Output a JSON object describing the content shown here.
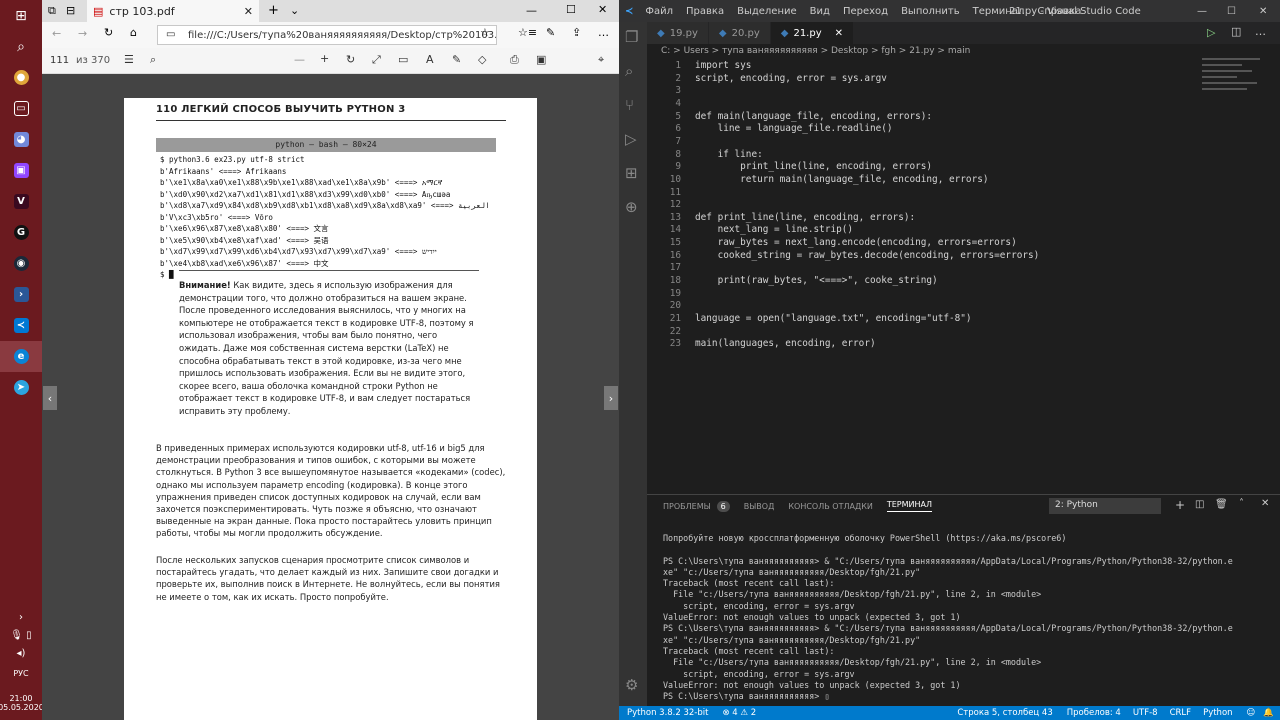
{
  "taskbar": {
    "items": [
      "windows-start",
      "search",
      "chrome",
      "taskview",
      "discord",
      "twitch",
      "vk",
      "game",
      "steam",
      "powershell",
      "vscode",
      "edge",
      "telegram"
    ],
    "tray": {
      "lang": "РУС",
      "time": "21:00",
      "date": "05.05.2020"
    }
  },
  "browser": {
    "tab_title": "стр 103.pdf",
    "url": "file:///C:/Users/тупа%20ваняяяяяяяяяя/Desktop/стр%20103.pdf",
    "page_current": "111",
    "page_total": "из 370",
    "pdf": {
      "header": "110   ЛЕГКИЙ СПОСОБ ВЫУЧИТЬ PYTHON 3",
      "terminal_title": "python — bash — 80×24",
      "terminal_lines": [
        "$ python3.6 ex23.py utf-8 strict",
        "b'Afrikaans' <===> Afrikaans",
        "b'\\xe1\\x8a\\xa0\\xe1\\x88\\x9b\\xe1\\x88\\xad\\xe1\\x8a\\x9b' <===> አማርኛ",
        "b'\\xd0\\x90\\xd2\\xa7\\xd1\\x81\\xd1\\x88\\xd3\\x99\\xd0\\xb0' <===> Аҧсшәа",
        "b'\\xd8\\xa7\\xd9\\x84\\xd8\\xb9\\xd8\\xb1\\xd8\\xa8\\xd9\\x8a\\xd8\\xa9' <===> العربية",
        "b'V\\xc3\\xb5ro' <===> Võro",
        "b'\\xe6\\x96\\x87\\xe8\\xa8\\x80' <===> 文言",
        "b'\\xe5\\x90\\xb4\\xe8\\xaf\\xad' <===> 吴语",
        "b'\\xd7\\x99\\xd7\\x99\\xd6\\xb4\\xd7\\x93\\xd7\\x99\\xd7\\xa9' <===> ייִדיש",
        "b'\\xe4\\xb8\\xad\\xe6\\x96\\x87' <===> 中文",
        "$ █"
      ],
      "note_bold": "Внимание!",
      "note_text": " Как видите, здесь я использую изображения для демонстрации того, что должно отобразиться на вашем экране. После проведенного исследования выяснилось, что у многих на компьютере не отображается текст в кодировке UTF-8, поэтому я использовал изображения, чтобы вам было понятно, чего ожидать. Даже моя собственная система верстки (LaTeX) не способна обрабатывать текст в этой кодировке, из-за чего мне пришлось использовать изображения. Если вы не видите этого, скорее всего, ваша оболочка командной строки Python не отображает текст в кодировке UTF-8, и вам следует постараться исправить эту проблему.",
      "para1": "В приведенных примерах используются кодировки utf-8, utf-16 и big5 для демонстрации преобразования и типов ошибок, с которыми вы можете столкнуться. В Python 3 все вышеупомянутое называется «кодеками» (codec), однако мы используем параметр encoding (кодировка). В конце этого упражнения приведен список доступных кодировок на случай, если вам захочется поэкспериментировать. Чуть позже я объясню, что означают выведенные на экран данные. Пока просто постарайтесь уловить принцип работы, чтобы мы могли продолжить обсуждение.",
      "para2": "После нескольких запусков сценария просмотрите список символов и постарайтесь угадать, что делает каждый из них. Запишите свои догадки и проверьте их, выполнив поиск в Интернете. Не волнуйтесь, если вы понятия не имеете о том, как их искать. Просто попробуйте."
    }
  },
  "vscode": {
    "menu": [
      "Файл",
      "Правка",
      "Выделение",
      "Вид",
      "Переход",
      "Выполнить",
      "Терминал",
      "Справка"
    ],
    "window_title": "21.py - Visual Studio Code",
    "tabs": [
      "19.py",
      "20.py",
      "21.py"
    ],
    "breadcrumb": "C: > Users > тупа ваняяяяяяяяяя > Desktop > fgh > 21.py > main",
    "code_lines": [
      {
        "n": "1",
        "t": "import sys"
      },
      {
        "n": "2",
        "t": "script, encoding, error = sys.argv"
      },
      {
        "n": "3",
        "t": ""
      },
      {
        "n": "4",
        "t": ""
      },
      {
        "n": "5",
        "t": "def main(language_file, encoding, errors):"
      },
      {
        "n": "6",
        "t": "    line = language_file.readline()"
      },
      {
        "n": "7",
        "t": ""
      },
      {
        "n": "8",
        "t": "    if line:"
      },
      {
        "n": "9",
        "t": "        print_line(line, encoding, errors)"
      },
      {
        "n": "10",
        "t": "        return main(language_file, encoding, errors)"
      },
      {
        "n": "11",
        "t": ""
      },
      {
        "n": "12",
        "t": ""
      },
      {
        "n": "13",
        "t": "def print_line(line, encoding, errors):"
      },
      {
        "n": "14",
        "t": "    next_lang = line.strip()"
      },
      {
        "n": "15",
        "t": "    raw_bytes = next_lang.encode(encoding, errors=errors)"
      },
      {
        "n": "16",
        "t": "    cooked_string = raw_bytes.decode(encoding, errors=errors)"
      },
      {
        "n": "17",
        "t": ""
      },
      {
        "n": "18",
        "t": "    print(raw_bytes, \"<===>\", cooke_string)"
      },
      {
        "n": "19",
        "t": ""
      },
      {
        "n": "20",
        "t": ""
      },
      {
        "n": "21",
        "t": "language = open(\"language.txt\", encoding=\"utf-8\")"
      },
      {
        "n": "22",
        "t": ""
      },
      {
        "n": "23",
        "t": "main(languages, encoding, error)"
      }
    ],
    "panel_tabs": [
      "ПРОБЛЕМЫ",
      "6",
      "ВЫВОД",
      "КОНСОЛЬ ОТЛАДКИ",
      "ТЕРМИНАЛ"
    ],
    "terminal_select": "2: Python",
    "terminal_text": "Попробуйте новую кроссплатформенную оболочку PowerShell (https://aka.ms/pscore6)\n\nPS C:\\Users\\тупа ваняяяяяяяяяя> & \"C:/Users/тупа ваняяяяяяяяяя/AppData/Local/Programs/Python/Python38-32/python.e\nxe\" \"c:/Users/тупа ваняяяяяяяяяя/Desktop/fgh/21.py\"\nTraceback (most recent call last):\n  File \"c:/Users/тупа ваняяяяяяяяяя/Desktop/fgh/21.py\", line 2, in <module>\n    script, encoding, error = sys.argv\nValueError: not enough values to unpack (expected 3, got 1)\nPS C:\\Users\\тупа ваняяяяяяяяяя> & \"C:/Users/тупа ваняяяяяяяяяя/AppData/Local/Programs/Python/Python38-32/python.e\nxe\" \"c:/Users/тупа ваняяяяяяяяяя/Desktop/fgh/21.py\"\nTraceback (most recent call last):\n  File \"c:/Users/тупа ваняяяяяяяяяя/Desktop/fgh/21.py\", line 2, in <module>\n    script, encoding, error = sys.argv\nValueError: not enough values to unpack (expected 3, got 1)\nPS C:\\Users\\тупа ваняяяяяяяяяя> ▯",
    "status": {
      "python": "Python 3.8.2 32-bit",
      "errors": "⊗ 4 ⚠ 2",
      "position": "Строка 5, столбец 43",
      "spaces": "Пробелов: 4",
      "enc": "UTF-8",
      "eol": "CRLF",
      "lang": "Python"
    }
  }
}
